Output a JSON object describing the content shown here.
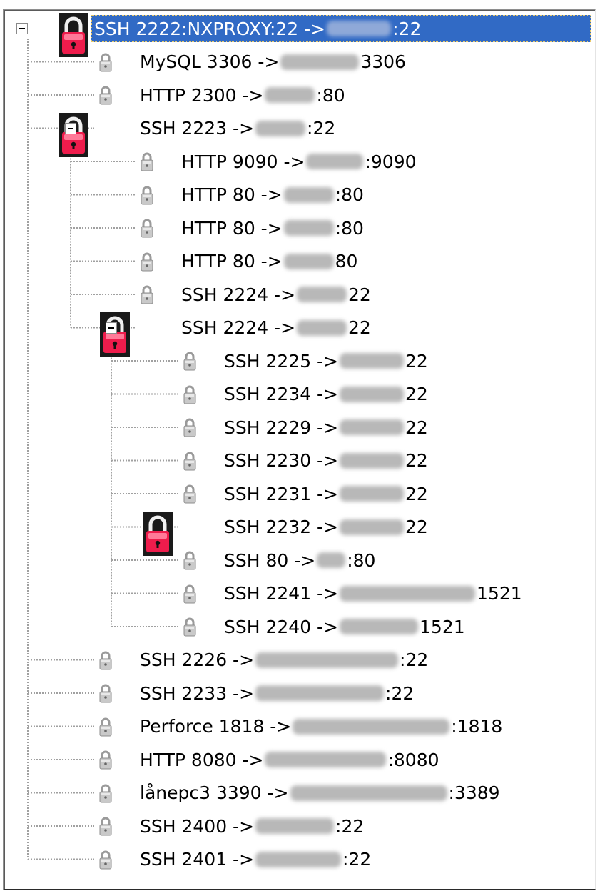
{
  "tree": {
    "rows": [
      {
        "prefix": "SSH 2222:NXPROXY:22 ->",
        "suffix": ":22",
        "active": true,
        "expanded": true,
        "selected": true,
        "level": 0
      },
      {
        "prefix": "MySQL 3306 ->",
        "suffix": "3306",
        "active": false,
        "level": 1
      },
      {
        "prefix": "HTTP 2300 ->",
        "suffix": ":80",
        "active": false,
        "level": 1
      },
      {
        "prefix": "SSH 2223 ->",
        "suffix": ":22",
        "active": true,
        "expanded": true,
        "level": 1
      },
      {
        "prefix": "HTTP 9090 ->",
        "suffix": ":9090",
        "active": false,
        "level": 2
      },
      {
        "prefix": "HTTP 80 ->",
        "suffix": ":80",
        "active": false,
        "level": 2
      },
      {
        "prefix": "HTTP 80 ->",
        "suffix": ":80",
        "active": false,
        "level": 2
      },
      {
        "prefix": "HTTP 80 ->",
        "suffix": "80",
        "active": false,
        "level": 2
      },
      {
        "prefix": "SSH 2224 ->",
        "suffix": "22",
        "active": false,
        "level": 2
      },
      {
        "prefix": "SSH 2224 ->",
        "suffix": "22",
        "active": true,
        "expanded": true,
        "level": 2
      },
      {
        "prefix": "SSH 2225 ->",
        "suffix": "22",
        "active": false,
        "level": 3
      },
      {
        "prefix": "SSH 2234 ->",
        "suffix": "22",
        "active": false,
        "level": 3
      },
      {
        "prefix": "SSH 2229 ->",
        "suffix": "22",
        "active": false,
        "level": 3
      },
      {
        "prefix": "SSH 2230 ->",
        "suffix": "22",
        "active": false,
        "level": 3
      },
      {
        "prefix": "SSH 2231 ->",
        "suffix": "22",
        "active": false,
        "level": 3
      },
      {
        "prefix": "SSH 2232 ->",
        "suffix": "22",
        "active": true,
        "level": 3
      },
      {
        "prefix": "SSH 80 ->",
        "suffix": ":80",
        "active": false,
        "level": 3
      },
      {
        "prefix": "SSH 2241 ->",
        "suffix": "1521",
        "active": false,
        "level": 3
      },
      {
        "prefix": "SSH 2240 ->",
        "suffix": "1521",
        "active": false,
        "level": 3
      },
      {
        "prefix": "SSH 2226 ->",
        "suffix": ":22",
        "active": false,
        "level": 1
      },
      {
        "prefix": "SSH 2233 ->",
        "suffix": ":22",
        "active": false,
        "level": 1
      },
      {
        "prefix": "Perforce 1818 ->",
        "suffix": ":1818",
        "active": false,
        "level": 1
      },
      {
        "prefix": "HTTP 8080 ->",
        "suffix": ":8080",
        "active": false,
        "level": 1
      },
      {
        "prefix": "lånepc3 3390 ->",
        "suffix": ":3389",
        "active": false,
        "level": 1
      },
      {
        "prefix": "SSH 2400 ->",
        "suffix": ":22",
        "active": false,
        "level": 1
      },
      {
        "prefix": "SSH 2401 ->",
        "suffix": ":22",
        "active": false,
        "level": 1
      }
    ]
  },
  "icons": {
    "active": "lock-active-icon",
    "inactive": "lock-inactive-icon",
    "expander": "collapse-minus-icon"
  },
  "colors": {
    "selection": "#316ac5",
    "active_lock": "#e8174a",
    "inactive_lock": "#a8a8a8"
  }
}
